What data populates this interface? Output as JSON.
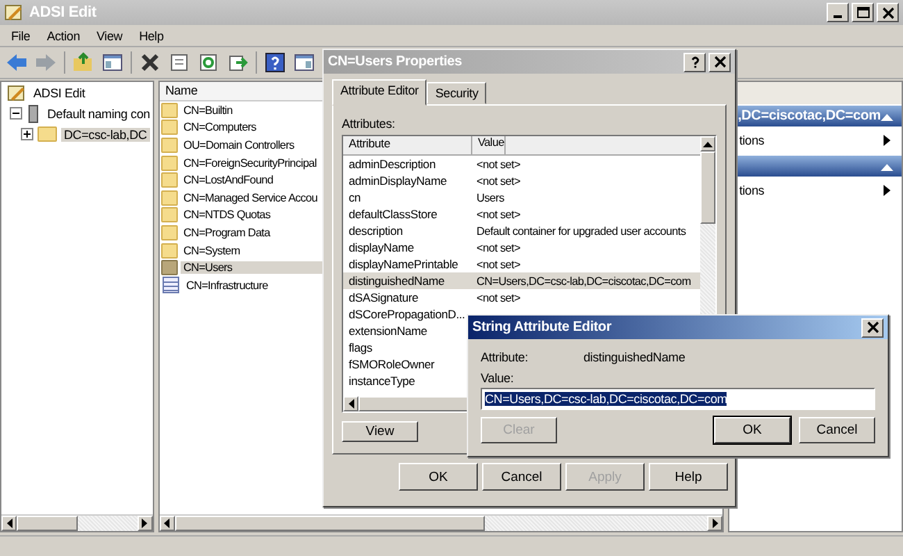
{
  "window": {
    "title": "ADSI Edit"
  },
  "menu": [
    "File",
    "Action",
    "View",
    "Help"
  ],
  "tree": [
    {
      "label": "ADSI Edit",
      "selected": false,
      "children": [
        {
          "label": "Default naming con",
          "expanded": true,
          "selected": false,
          "children": [
            {
              "label": "DC=csc-lab,DC",
              "expanded": false,
              "selected": true
            }
          ]
        }
      ]
    }
  ],
  "list": {
    "column": "Name",
    "items": [
      {
        "label": "CN=Builtin",
        "kind": "folder",
        "selected": false
      },
      {
        "label": "CN=Computers",
        "kind": "folder",
        "selected": false
      },
      {
        "label": "OU=Domain Controllers",
        "kind": "folder",
        "selected": false
      },
      {
        "label": "CN=ForeignSecurityPrincipal",
        "kind": "folder",
        "selected": false
      },
      {
        "label": "CN=LostAndFound",
        "kind": "folder",
        "selected": false
      },
      {
        "label": "CN=Managed Service Accou",
        "kind": "folder",
        "selected": false
      },
      {
        "label": "CN=NTDS Quotas",
        "kind": "folder",
        "selected": false
      },
      {
        "label": "CN=Program Data",
        "kind": "folder",
        "selected": false
      },
      {
        "label": "CN=System",
        "kind": "folder",
        "selected": false
      },
      {
        "label": "CN=Users",
        "kind": "folder",
        "selected": true
      },
      {
        "label": "CN=Infrastructure",
        "kind": "object",
        "selected": false
      }
    ]
  },
  "actions": [
    {
      "title": ",DC=ciscotac,DC=com",
      "items": [
        "tions"
      ]
    },
    {
      "items": [
        "tions"
      ]
    }
  ],
  "properties_dialog": {
    "title": "CN=Users Properties",
    "tabs": [
      {
        "label": "Attribute Editor",
        "selected": true
      },
      {
        "label": "Security",
        "selected": false
      }
    ],
    "attributes_label": "Attributes:",
    "columns": [
      "Attribute",
      "Value"
    ],
    "rows": [
      {
        "attribute": "adminDescription",
        "value": "<not set>",
        "selected": false
      },
      {
        "attribute": "adminDisplayName",
        "value": "<not set>",
        "selected": false
      },
      {
        "attribute": "cn",
        "value": "Users",
        "selected": false
      },
      {
        "attribute": "defaultClassStore",
        "value": "<not set>",
        "selected": false
      },
      {
        "attribute": "description",
        "value": "Default container for upgraded user accounts",
        "selected": false
      },
      {
        "attribute": "displayName",
        "value": "<not set>",
        "selected": false
      },
      {
        "attribute": "displayNamePrintable",
        "value": "<not set>",
        "selected": false
      },
      {
        "attribute": "distinguishedName",
        "value": "CN=Users,DC=csc-lab,DC=ciscotac,DC=com",
        "selected": true
      },
      {
        "attribute": "dSASignature",
        "value": "<not set>",
        "selected": false
      },
      {
        "attribute": "dSCorePropagationD...",
        "selected": false
      },
      {
        "attribute": "extensionName",
        "selected": false
      },
      {
        "attribute": "flags",
        "selected": false
      },
      {
        "attribute": "fSMORoleOwner",
        "selected": false
      },
      {
        "attribute": "instanceType",
        "selected": false
      }
    ],
    "view_button": "View",
    "buttons": [
      {
        "label": "OK",
        "disabled": false
      },
      {
        "label": "Cancel",
        "disabled": false
      },
      {
        "label": "Apply",
        "disabled": true
      },
      {
        "label": "Help",
        "disabled": false
      }
    ]
  },
  "string_editor": {
    "title": "String Attribute Editor",
    "attribute_label": "Attribute:",
    "attribute_value": "distinguishedName",
    "value_label": "Value:",
    "value": "CN=Users,DC=csc-lab,DC=ciscotac,DC=com",
    "clear_button": {
      "label": "Clear",
      "disabled": true
    },
    "buttons": [
      {
        "label": "OK",
        "disabled": false
      },
      {
        "label": "Cancel",
        "disabled": false
      }
    ]
  }
}
